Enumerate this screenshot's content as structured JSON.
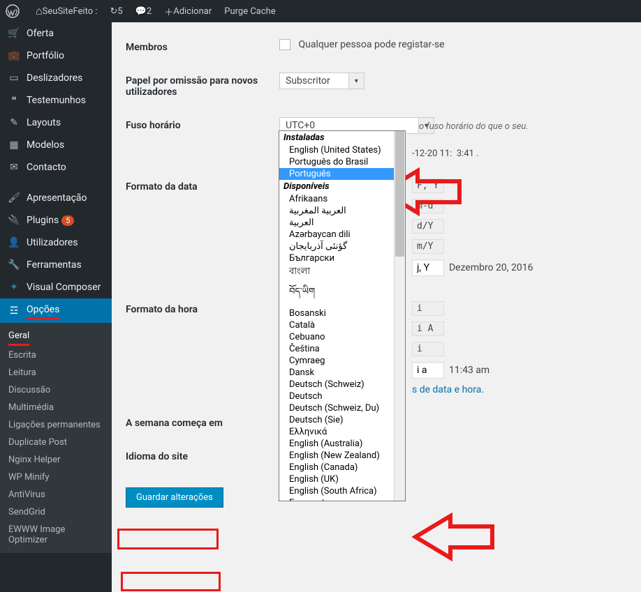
{
  "toolbar": {
    "site_name": "SeuSiteFeito :",
    "refresh_count": "5",
    "comments_count": "2",
    "add_label": "Adicionar",
    "purge_label": "Purge Cache"
  },
  "sidebar": {
    "items": [
      {
        "label": "Oferta"
      },
      {
        "label": "Portfólio"
      },
      {
        "label": "Deslizadores"
      },
      {
        "label": "Testemunhos"
      },
      {
        "label": "Layouts"
      },
      {
        "label": "Modelos"
      },
      {
        "label": "Contacto"
      },
      {
        "label": "Apresentação"
      },
      {
        "label": "Plugins",
        "badge": "5"
      },
      {
        "label": "Utilizadores"
      },
      {
        "label": "Ferramentas"
      },
      {
        "label": "Visual Composer"
      },
      {
        "label": "Opções"
      }
    ],
    "submenu": [
      "Geral",
      "Escrita",
      "Leitura",
      "Discussão",
      "Multimédia",
      "Ligações permanentes",
      "Duplicate Post",
      "Nginx Helper",
      "WP Minify",
      "AntiVirus",
      "SendGrid",
      "EWWW Image Optimizer"
    ]
  },
  "form": {
    "members_label": "Membros",
    "members_desc": "Qualquer pessoa pode registar-se",
    "default_role_label": "Papel por omissão para novos utilizadores",
    "default_role_value": "Subscritor",
    "timezone_label": "Fuso horário",
    "timezone_value": "UTC+0",
    "timezone_desc_suffix": "o fuso horário do que o seu.",
    "utc_time": "-12-20 11:",
    "utc_time_suffix": "3:41",
    "date_format_label": "Formato da data",
    "date_codes": [
      "F, Y",
      "m-d",
      "d/Y",
      "m/Y"
    ],
    "date_custom_code": "j, Y",
    "date_custom_preview": "Dezembro 20, 2016",
    "time_format_label": "Formato da hora",
    "time_codes": [
      "i",
      "i A",
      "i"
    ],
    "time_custom_code": "i a",
    "time_custom_preview": "11:43 am",
    "format_doc_link": "s de data e hora",
    "week_starts_label": "A semana começa em",
    "site_lang_label": "Idioma do site",
    "site_lang_value": "Português",
    "save_label": "Guardar alterações"
  },
  "dropdown": {
    "installed_header": "Instaladas",
    "installed": [
      "English (United States)",
      "Português do Brasil",
      "Português"
    ],
    "available_header": "Disponíveis",
    "available": [
      "Afrikaans",
      "العربية المغربية",
      "العربية",
      "Azərbaycan dili",
      "گؤنئی آذربایجان",
      "Български",
      "বাংলা",
      "བོད་ཡིག",
      "Bosanski",
      "Català",
      "Cebuano",
      "Čeština",
      "Cymraeg",
      "Dansk",
      "Deutsch (Schweiz)",
      "Deutsch",
      "Deutsch (Schweiz, Du)",
      "Deutsch (Sie)",
      "Ελληνικά",
      "English (Australia)",
      "English (New Zealand)",
      "English (Canada)",
      "English (UK)",
      "English (South Africa)",
      "Esperanto"
    ]
  }
}
